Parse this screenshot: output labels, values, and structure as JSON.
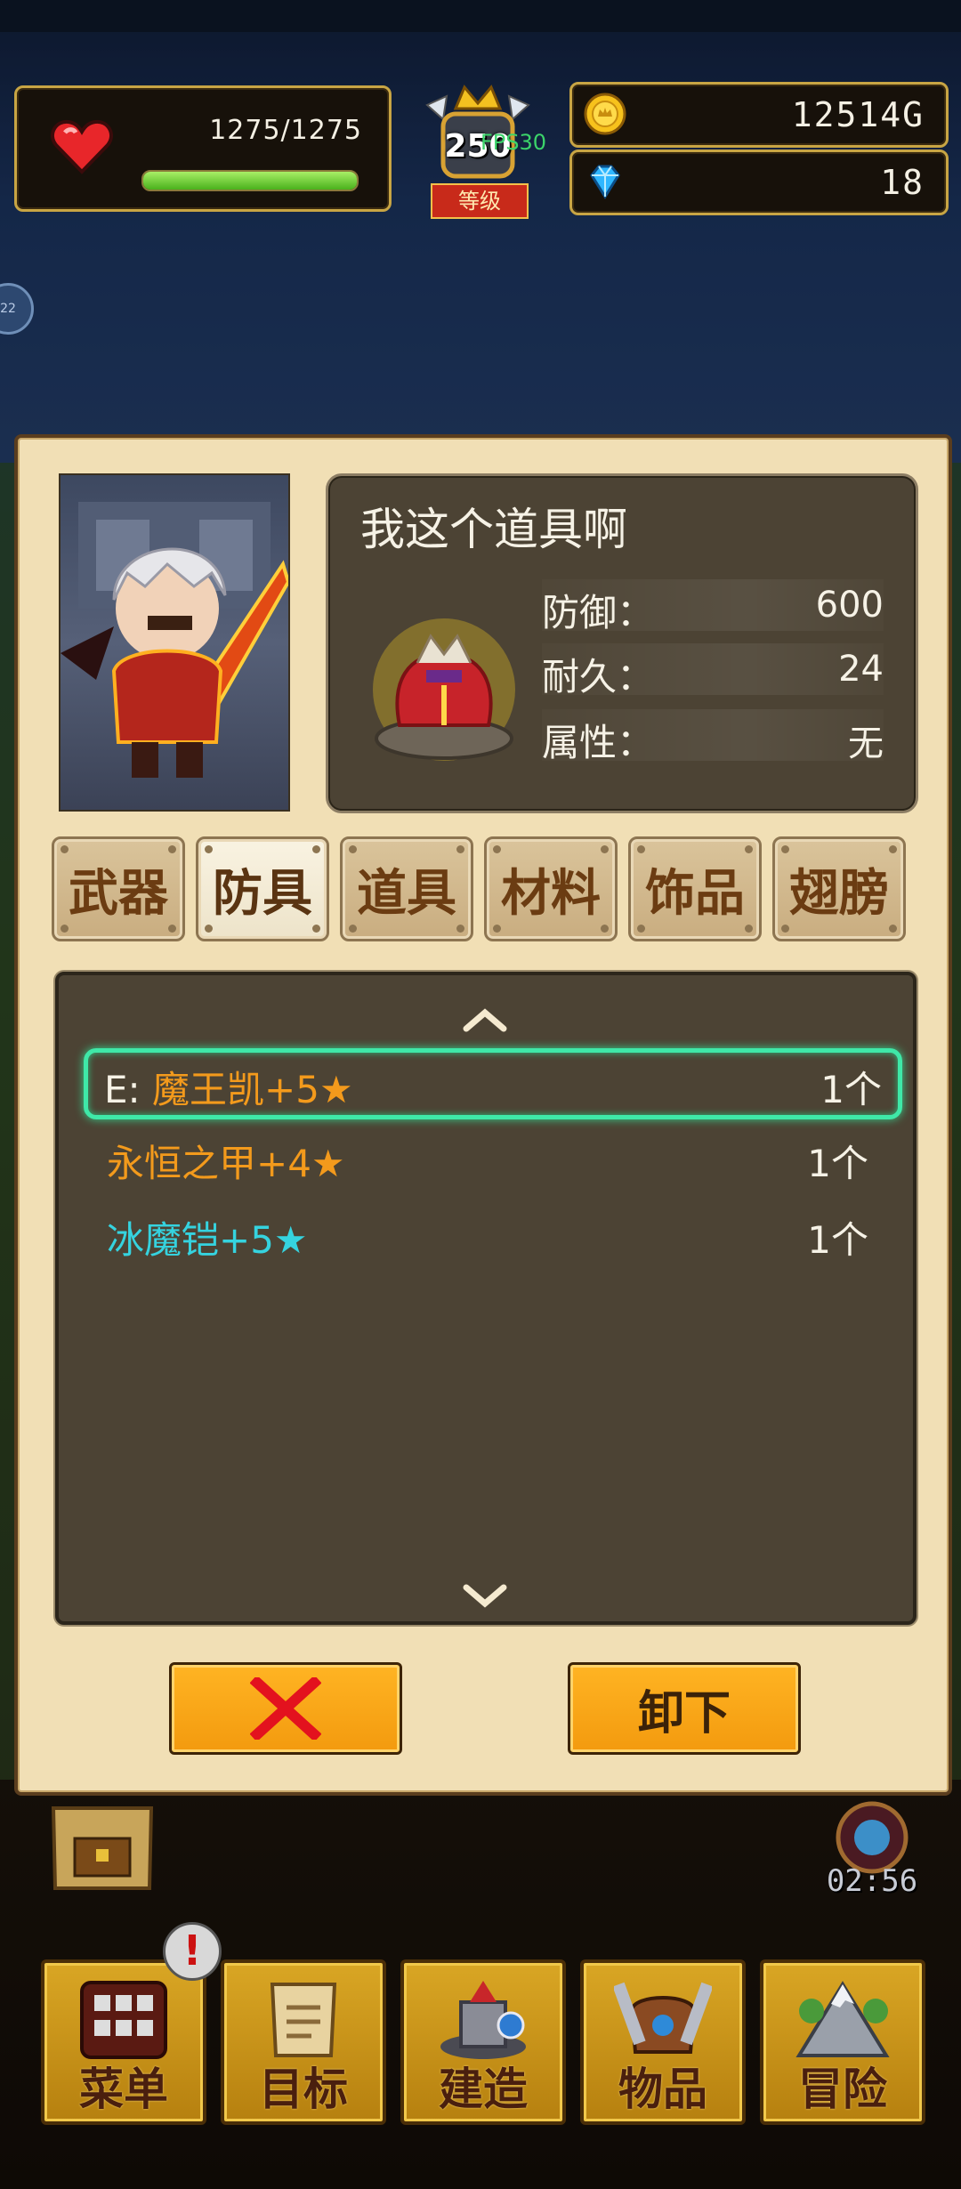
{
  "hud": {
    "hp_text": "1275/1275",
    "hp_fraction": 1.0,
    "level": "250",
    "level_label": "等级",
    "fps": "FPS30",
    "gold": "12514G",
    "gems": "18",
    "side_bubble": "22"
  },
  "detail": {
    "item_name": "我这个道具啊",
    "stats": [
      {
        "label": "防御：",
        "value": "600"
      },
      {
        "label": "耐久：",
        "value": "24"
      },
      {
        "label": "属性：",
        "value": "无"
      }
    ]
  },
  "tabs": [
    "武器",
    "防具",
    "道具",
    "材料",
    "饰品",
    "翅膀"
  ],
  "active_tab": "防具",
  "items": [
    {
      "name": "E: 魔王凯+5★",
      "count": "1个",
      "color": "#f39a1c",
      "selected": true
    },
    {
      "name": "永恒之甲+4★",
      "count": "1个",
      "color": "#f39a1c",
      "selected": false
    },
    {
      "name": "冰魔铠+5★",
      "count": "1个",
      "color": "#35d3df",
      "selected": false
    }
  ],
  "buttons": {
    "cancel_icon": "close-icon",
    "unequip_label": "卸下"
  },
  "timer": "02:56",
  "nav": [
    "菜单",
    "目标",
    "建造",
    "物品",
    "冒险"
  ],
  "alert": "!",
  "colors": {
    "panel": "#f1dfb5",
    "list_bg": "#4c4334",
    "button": "#f7a314",
    "selection": "#3fe8a8"
  }
}
